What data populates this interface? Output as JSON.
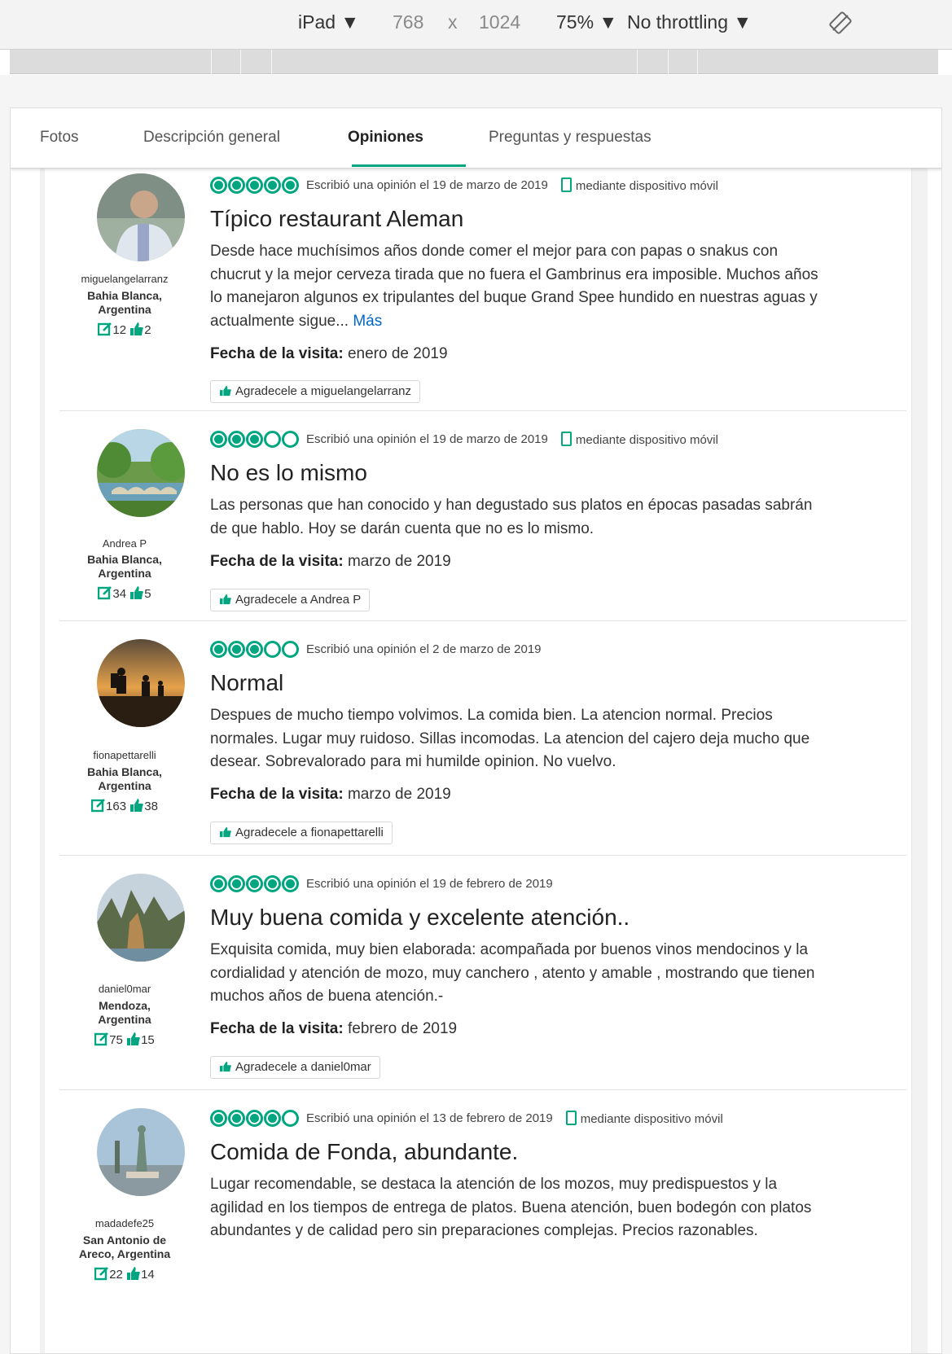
{
  "devtools": {
    "device": "iPad ▼",
    "width": "768",
    "times": "x",
    "height": "1024",
    "zoom": "75% ▼",
    "throttling": "No throttling ▼"
  },
  "tabs": [
    {
      "label": "Fotos",
      "active": false
    },
    {
      "label": "Descripción general",
      "active": false
    },
    {
      "label": "Opiniones",
      "active": true
    },
    {
      "label": "Preguntas y respuestas",
      "active": false
    }
  ],
  "accent_color": "#00a680",
  "reviews": [
    {
      "user": "miguelangelarranz",
      "loc1": "Bahia Blanca,",
      "loc2": "Argentina",
      "reviews_count": "12",
      "helpful_count": "2",
      "rating": 5,
      "date": "Escribió una opinión el 19 de marzo de 2019",
      "mobile": "mediante dispositivo móvil",
      "title": "Típico restaurant Aleman",
      "text": "Desde hace muchísimos años donde comer el mejor para con papas o snakus con chucrut y la mejor cerveza tirada que no fuera el Gambrinus era imposible. Muchos años lo manejaron algunos ex tripulantes del buque Grand Spee hundido en nuestras aguas y actualmente sigue...",
      "more": "Más",
      "visit_label": "Fecha de la visita:",
      "visit": "enero de 2019",
      "thanks": "Agradecele a miguelangelarranz"
    },
    {
      "user": "Andrea P",
      "loc1": "Bahia Blanca,",
      "loc2": "Argentina",
      "reviews_count": "34",
      "helpful_count": "5",
      "rating": 3,
      "date": "Escribió una opinión el 19 de marzo de 2019",
      "mobile": "mediante dispositivo móvil",
      "title": "No es lo mismo",
      "text": "Las personas que han conocido y han degustado sus platos en épocas pasadas sabrán de que hablo. Hoy se darán cuenta que no es lo mismo.",
      "visit_label": "Fecha de la visita:",
      "visit": "marzo de 2019",
      "thanks": "Agradecele a Andrea P"
    },
    {
      "user": "fionapettarelli",
      "loc1": "Bahia Blanca,",
      "loc2": "Argentina",
      "reviews_count": "163",
      "helpful_count": "38",
      "rating": 3,
      "date": "Escribió una opinión el 2 de marzo de 2019",
      "title": "Normal",
      "text": "Despues de mucho tiempo volvimos. La comida bien. La atencion normal. Precios normales. Lugar muy ruidoso. Sillas incomodas. La atencion del cajero deja mucho que desear. Sobrevalorado para mi humilde opinion. No vuelvo.",
      "visit_label": "Fecha de la visita:",
      "visit": "marzo de 2019",
      "thanks": "Agradecele a fionapettarelli"
    },
    {
      "user": "daniel0mar",
      "loc1": "Mendoza,",
      "loc2": "Argentina",
      "reviews_count": "75",
      "helpful_count": "15",
      "rating": 5,
      "date": "Escribió una opinión el 19 de febrero de 2019",
      "title": "Muy buena comida y excelente atención..",
      "text": "Exquisita comida, muy bien elaborada: acompañada por buenos vinos mendocinos y la cordialidad y atención de mozo, muy canchero , atento y amable , mostrando que tienen muchos años de buena atención.-",
      "visit_label": "Fecha de la visita:",
      "visit": "febrero de 2019",
      "thanks": "Agradecele a daniel0mar"
    },
    {
      "user": "madadefe25",
      "loc1": "San Antonio de",
      "loc2": "Areco, Argentina",
      "reviews_count": "22",
      "helpful_count": "14",
      "rating": 4,
      "date": "Escribió una opinión el 13 de febrero de 2019",
      "mobile": "mediante dispositivo móvil",
      "title": "Comida de Fonda, abundante.",
      "text": "Lugar recomendable, se destaca la atención de los mozos, muy predispuestos y la agilidad en los tiempos de entrega de platos. Buena atención, buen bodegón con platos abundantes y de calidad pero sin preparaciones complejas. Precios razonables."
    }
  ]
}
